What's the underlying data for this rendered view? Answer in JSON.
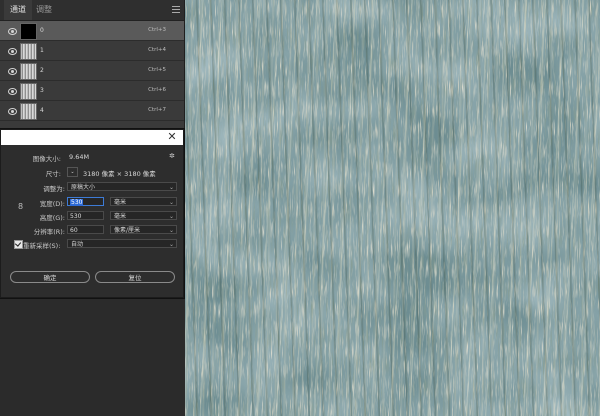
{
  "channels_panel": {
    "tabs": [
      {
        "label": "通道",
        "active": true
      },
      {
        "label": "调整",
        "active": false
      }
    ],
    "rows": [
      {
        "name": "0",
        "shortcut": "Ctrl+3",
        "thumb": "black",
        "selected": true
      },
      {
        "name": "1",
        "shortcut": "Ctrl+4",
        "thumb": "texture",
        "selected": false
      },
      {
        "name": "2",
        "shortcut": "Ctrl+5",
        "thumb": "texture",
        "selected": false
      },
      {
        "name": "3",
        "shortcut": "Ctrl+6",
        "thumb": "texture",
        "selected": false
      },
      {
        "name": "4",
        "shortcut": "Ctrl+7",
        "thumb": "texture",
        "selected": false
      }
    ]
  },
  "dialog": {
    "image_size_label": "图像大小:",
    "image_size_value": "9.64M",
    "dimensions_label": "尺寸:",
    "dimensions_value": "3180 像素 × 3180 像素",
    "fit_to_label": "调整为:",
    "fit_to_value": "原稿大小",
    "width_label": "宽度(D):",
    "width_value": "530",
    "width_unit": "毫米",
    "height_label": "高度(G):",
    "height_value": "530",
    "height_unit": "毫米",
    "resolution_label": "分辨率(R):",
    "resolution_value": "60",
    "resolution_unit": "像素/厘米",
    "resample_label": "重新采样(S):",
    "resample_value": "自动",
    "resample_checked": true,
    "ok_label": "确定",
    "reset_label": "复位",
    "close_glyph": "✕",
    "gear_glyph": "✲",
    "chain_glyph": "8"
  },
  "colors": {
    "texture_base": "#6d8d92",
    "texture_light": "#d8cfb2",
    "texture_dark": "#3f5a4c",
    "focus_blue": "#2d6ad6"
  },
  "icons": [
    "eye-icon",
    "channel-thumbnail",
    "panel-menu-icon",
    "close-icon",
    "gear-icon",
    "chain-link-icon",
    "chevron-down-icon",
    "checkbox-checked-icon"
  ]
}
